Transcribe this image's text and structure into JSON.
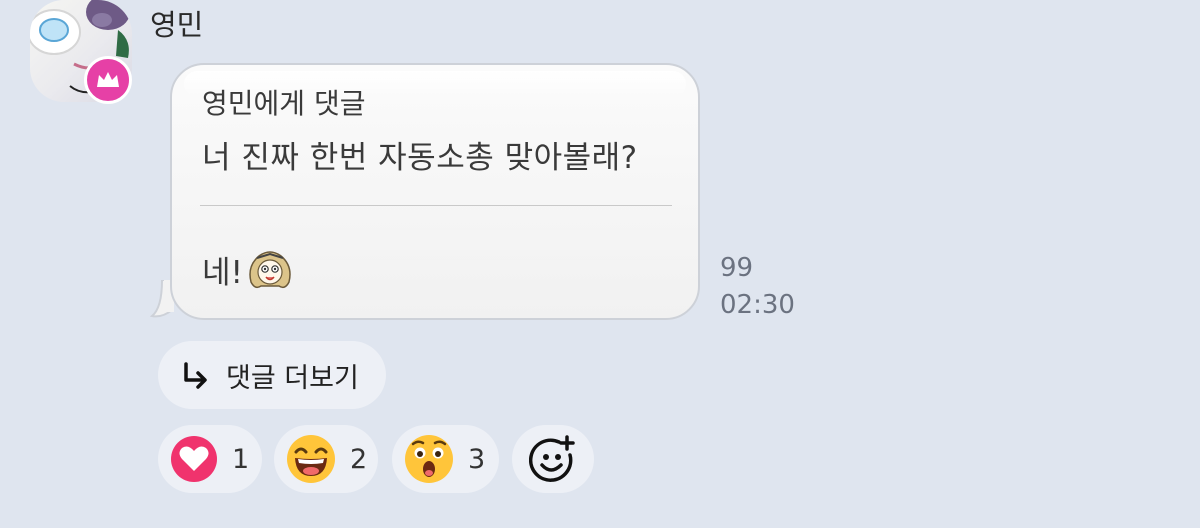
{
  "message": {
    "sender_name": "영민",
    "reply_to_label": "영민에게 댓글",
    "quoted_text": "너 진짜 한번 자동소총 맞아볼래?",
    "reply_text": "네!",
    "unread_count": "99",
    "time": "02:30"
  },
  "thread": {
    "more_replies_label": "댓글 더보기"
  },
  "reactions": [
    {
      "icon": "heart-icon",
      "count": "1"
    },
    {
      "icon": "grinning-face-icon",
      "count": "2"
    },
    {
      "icon": "surprised-face-icon",
      "count": "3"
    }
  ],
  "colors": {
    "background": "#dfe5ef",
    "bubble": "#f6f6f6",
    "crown_badge": "#e640a6",
    "heart": "#f0336d",
    "emoji_yellow": "#ffc53a"
  }
}
